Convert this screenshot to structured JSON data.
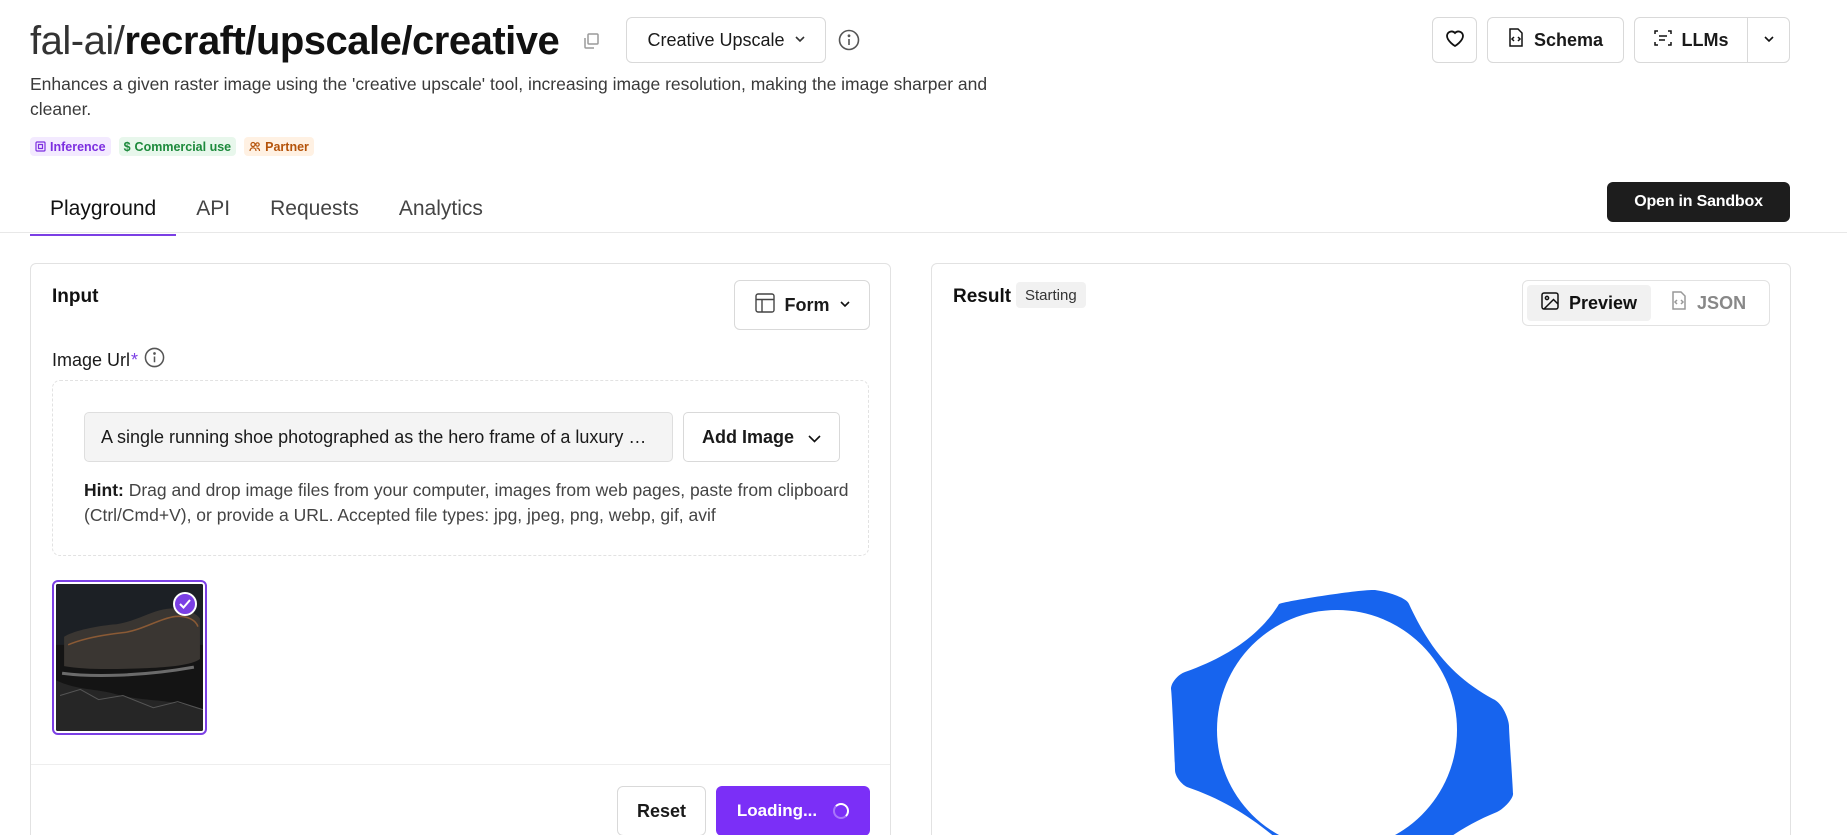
{
  "header": {
    "owner": "fal-ai/",
    "path": "recraft/upscale/creative",
    "endpoint": "Creative Upscale",
    "description": "Enhances a given raster image using the 'creative upscale' tool, increasing image resolution, making the image sharper and cleaner.",
    "badges": {
      "inference": "Inference",
      "commercial": "Commercial use",
      "partner": "Partner"
    },
    "schema_label": "Schema",
    "llms_label": "LLMs"
  },
  "tabs": {
    "playground": "Playground",
    "api": "API",
    "requests": "Requests",
    "analytics": "Analytics"
  },
  "sandbox_label": "Open in Sandbox",
  "input": {
    "title": "Input",
    "form_label": "Form",
    "image_url_label": "Image Url",
    "required_mark": "*",
    "image_url_value": "A single running shoe photographed as the hero frame of a luxury …",
    "add_image_label": "Add Image",
    "hint_label": "Hint:",
    "hint_text": " Drag and drop image files from your computer, images from web pages, paste from clipboard (Ctrl/Cmd+V), or provide a URL. Accepted file types: jpg, jpeg, png, webp, gif, avif",
    "reset_label": "Reset",
    "submit_label": "Loading..."
  },
  "result": {
    "title": "Result",
    "status": "Starting",
    "preview_label": "Preview",
    "json_label": "JSON"
  },
  "colors": {
    "accent": "#7b2ff7",
    "logo_blue": "#1764ee",
    "dark_button": "#1d1d1d"
  }
}
